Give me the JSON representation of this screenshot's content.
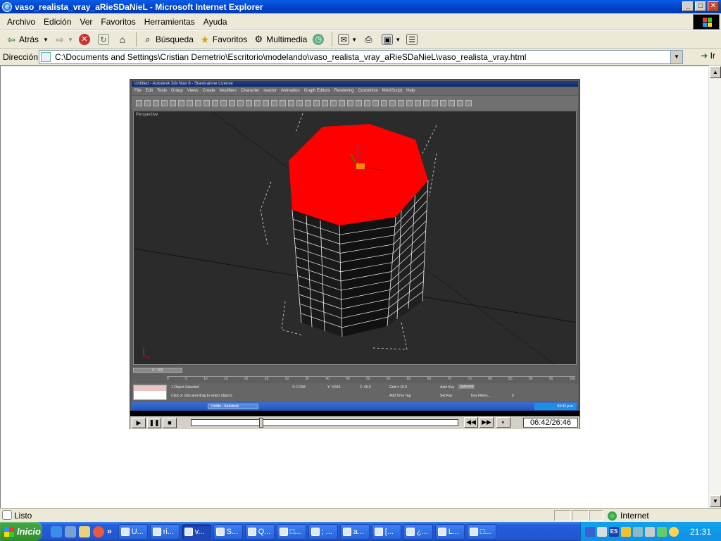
{
  "window": {
    "title": "vaso_realista_vray_aRieSDaNieL - Microsoft Internet Explorer"
  },
  "menu": [
    "Archivo",
    "Edición",
    "Ver",
    "Favoritos",
    "Herramientas",
    "Ayuda"
  ],
  "toolbar": {
    "back": "Atrás",
    "search": "Búsqueda",
    "favorites": "Favoritos",
    "media": "Multimedia"
  },
  "address": {
    "label": "Dirección",
    "value": "C:\\Documents and Settings\\Cristian Demetrio\\Escritorio\\modelando\\vaso_realista_vray_aRieSDaNieL\\vaso_realista_vray.html",
    "go": "Ir"
  },
  "movie": {
    "max_title": "Untitled - Autodesk 3ds Max 8 - Stand-alone License",
    "max_menu": [
      "File",
      "Edit",
      "Tools",
      "Group",
      "Views",
      "Create",
      "Modifiers",
      "Character",
      "reactor",
      "Animation",
      "Graph Editors",
      "Rendering",
      "Customize",
      "MAXScript",
      "Help"
    ],
    "viewport_label": "Perspective",
    "time_slider": "0 / 100",
    "ruler_ticks": [
      "0",
      "5",
      "10",
      "15",
      "20",
      "25",
      "30",
      "35",
      "40",
      "45",
      "50",
      "55",
      "60",
      "65",
      "70",
      "75",
      "80",
      "85",
      "90",
      "95",
      "100"
    ],
    "status_selected": "1 Object Selected",
    "status_prompt": "Click or click-and-drag to select objects",
    "x_value": "0.258",
    "y_value": "0.569",
    "z_value": "45.0",
    "grid": "Grid = 10.0",
    "auto_key": "Auto Key",
    "selected": "Selected",
    "set_key": "Set Key",
    "key_filters": "Key Filters...",
    "add_time_tag": "Add Time Tag",
    "frame_value": "0",
    "inner_task": "Untitle - Autodesk",
    "inner_clock": "04:32 p.m.",
    "playback_time": "06:42/26:46",
    "seek_fraction": 0.258,
    "cap_color": "#ff0000"
  },
  "statusbar": {
    "text": "Listo",
    "zone": "Internet"
  },
  "taskbar": {
    "start": "Inicio",
    "tasks": [
      "U...",
      "ri...",
      "v...",
      "S...",
      "Q...",
      "□...",
      "; ...",
      "a...",
      "[...",
      "¿...",
      "L...",
      "□..."
    ],
    "clock": "21:31",
    "lang": "ES"
  }
}
